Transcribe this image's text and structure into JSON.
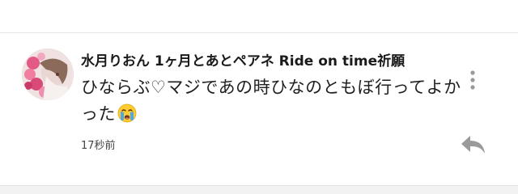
{
  "comment": {
    "author": "水月りおん 1ヶ月とあとペアネ Ride on time祈願",
    "text": "ひならぶ♡マジであの時ひなのともぼ行ってよかった",
    "emoji": "crying-face",
    "timestamp": "17秒前"
  },
  "icons": {
    "menu": "vertical-dots-icon",
    "reply": "reply-arrow-icon"
  },
  "colors": {
    "icon": "#9a9a9a",
    "text": "#1f1f1f",
    "divider": "#e6e6e6"
  }
}
